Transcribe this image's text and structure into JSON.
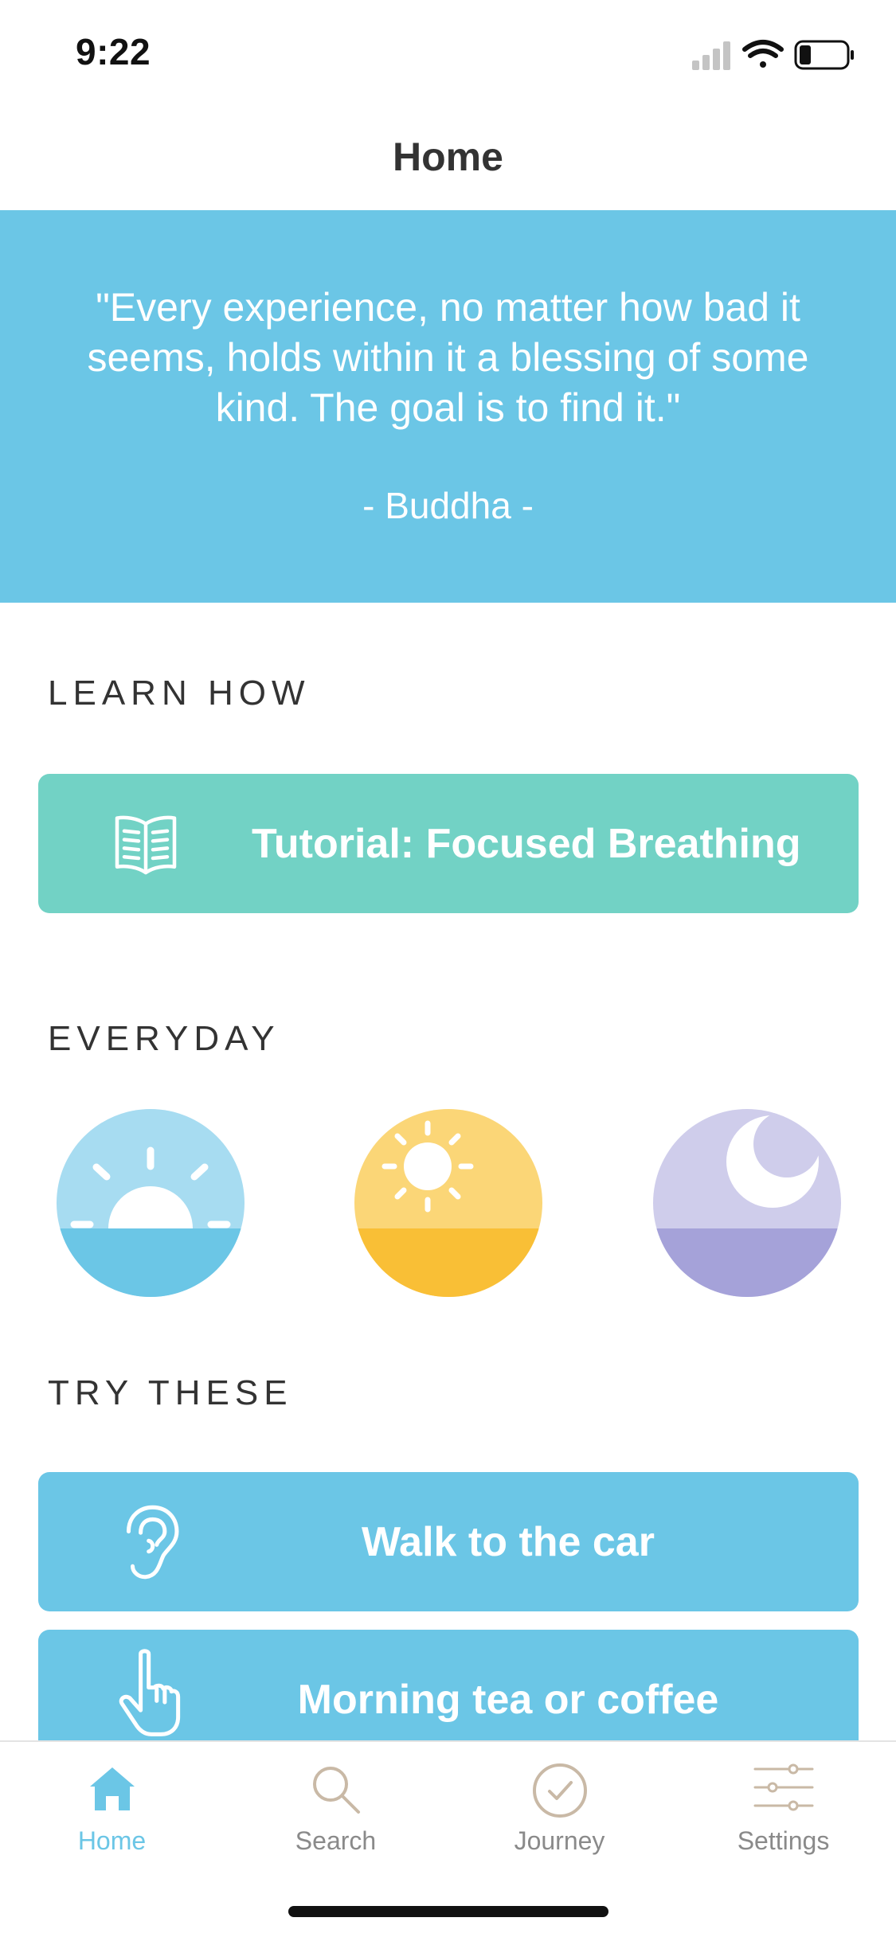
{
  "status_bar": {
    "time": "9:22"
  },
  "nav": {
    "title": "Home"
  },
  "quote": {
    "text": "\"Every experience, no matter how bad it seems, holds within it a blessing of some kind. The goal is to find it.\"",
    "author": "- Buddha -"
  },
  "sections": {
    "learn_how": "LEARN HOW",
    "everyday": "EVERYDAY",
    "try_these": "TRY THESE"
  },
  "tutorial": {
    "label": "Tutorial: Focused Breathing",
    "icon": "book-icon"
  },
  "everyday": [
    {
      "icon": "sunrise-icon"
    },
    {
      "icon": "sun-icon"
    },
    {
      "icon": "moon-icon"
    }
  ],
  "try_these": [
    {
      "label": "Walk to the car",
      "icon": "ear-icon"
    },
    {
      "label": "Morning tea or coffee",
      "icon": "pointing-hand-icon"
    }
  ],
  "tabs": [
    {
      "label": "Home",
      "icon": "home-icon",
      "active": true
    },
    {
      "label": "Search",
      "icon": "search-icon",
      "active": false
    },
    {
      "label": "Journey",
      "icon": "check-circle-icon",
      "active": false
    },
    {
      "label": "Settings",
      "icon": "sliders-icon",
      "active": false
    }
  ],
  "colors": {
    "accent_blue": "#6bc6e6",
    "teal": "#72d2c5",
    "sunrise_light": "#a7dcf1",
    "sun_light": "#fbd677",
    "sun_dark": "#f9bf36",
    "moon_light": "#cfcdeb",
    "moon_dark": "#a5a2d9",
    "inactive_tab": "#8a8a8a"
  }
}
